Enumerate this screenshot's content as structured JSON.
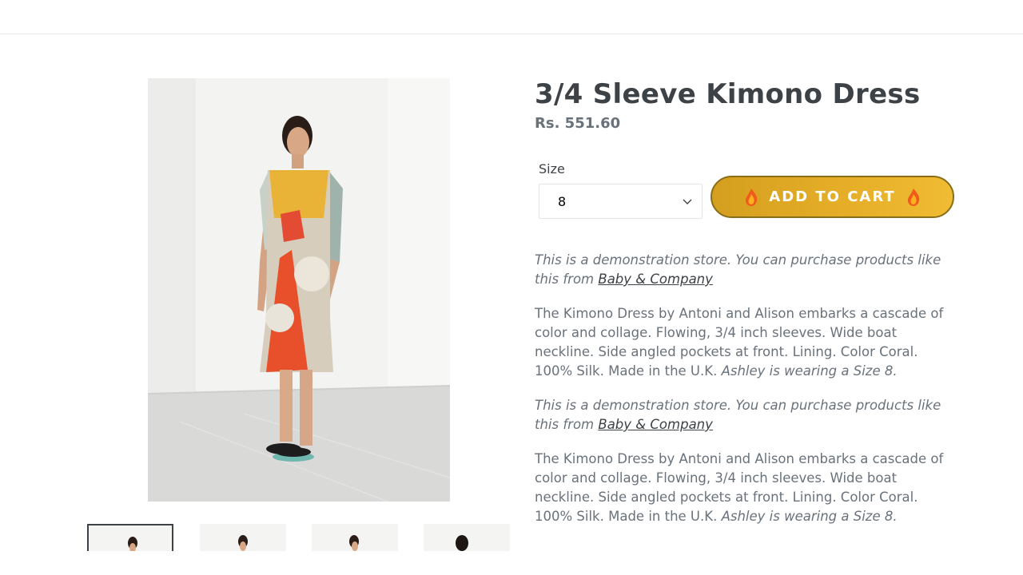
{
  "product": {
    "title": "3/4 Sleeve Kimono Dress",
    "price": "Rs. 551.60",
    "size_label": "Size",
    "size_value": "8",
    "add_to_cart_label": "ADD TO CART"
  },
  "description": [
    {
      "demo_text": "This is a demonstration store. You can purchase products like this from",
      "demo_link": "Baby & Company"
    },
    {
      "body": "The Kimono Dress by Antoni and Alison embarks a cascade of color and collage. Flowing, 3/4 inch sleeves. Wide boat neckline. Side angled pockets at front. Lining. Color Coral. 100% Silk. Made in the U.K.",
      "body_italic": "Ashley is wearing a Size 8."
    },
    {
      "demo_text": "This is a demonstration store. You can purchase products like this from",
      "demo_link": "Baby & Company"
    },
    {
      "body": "The Kimono Dress by Antoni and Alison embarks a cascade of color and collage. Flowing, 3/4 inch sleeves. Wide boat neckline. Side angled pockets at front. Lining. Color Coral. 100% Silk. Made in the U.K.",
      "body_italic": "Ashley is wearing a Size 8."
    }
  ],
  "colors": {
    "text": "#3d4246",
    "muted": "#69727b",
    "button": "#e6ae28",
    "button_border": "#8a6d18"
  },
  "icons": [
    "flame-icon",
    "chevron-down-icon"
  ]
}
